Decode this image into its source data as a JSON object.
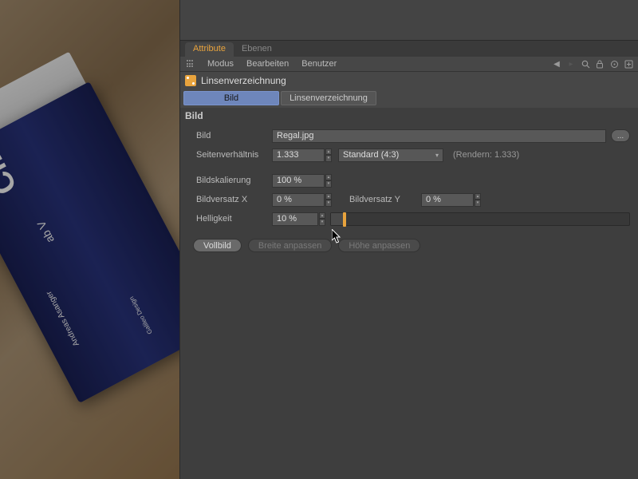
{
  "viewport": {
    "book_title": "Cinema",
    "book_sub": "ab V",
    "book_author": "Andreas\nAsanger",
    "book_logo": "Galileo\nDesign"
  },
  "tabs": {
    "attribute": "Attribute",
    "ebenen": "Ebenen"
  },
  "menubar": {
    "modus": "Modus",
    "bearbeiten": "Bearbeiten",
    "benutzer": "Benutzer"
  },
  "object": {
    "name": "Linsenverzeichnung"
  },
  "subtabs": {
    "bild": "Bild",
    "linsen": "Linsenverzeichnung"
  },
  "section": {
    "bild": "Bild"
  },
  "fields": {
    "bild_label": "Bild",
    "bild_value": "Regal.jpg",
    "seiten_label": "Seitenverhältnis",
    "seiten_value": "1.333",
    "seiten_preset": "Standard (4:3)",
    "render_text": "(Rendern: 1.333)",
    "bsk_label": "Bildskalierung",
    "bsk_value": "100 %",
    "bvx_label": "Bildversatz X",
    "bvx_value": "0 %",
    "bvy_label": "Bildversatz Y",
    "bvy_value": "0 %",
    "hell_label": "Helligkeit",
    "hell_value": "10 %"
  },
  "buttons": {
    "vollbild": "Vollbild",
    "breite": "Breite anpassen",
    "hoehe": "Höhe anpassen",
    "ellipsis": "..."
  }
}
